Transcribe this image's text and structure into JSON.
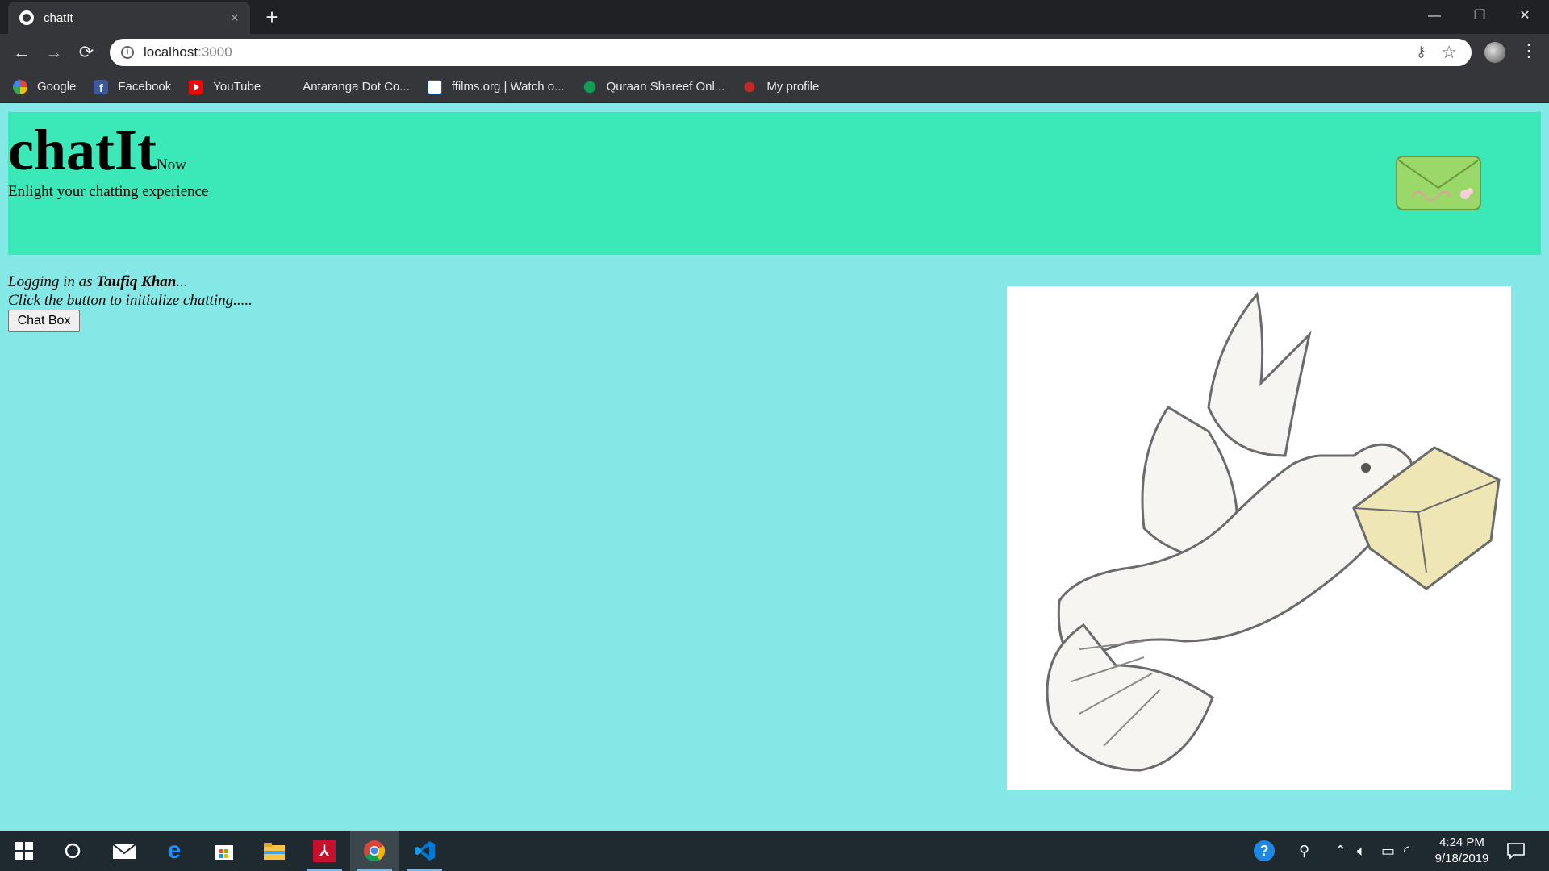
{
  "browser": {
    "tab_title": "chatIt",
    "tab_close": "×",
    "new_tab": "+",
    "window_controls": {
      "minimize": "—",
      "restore": "❐",
      "close": "✕"
    },
    "nav": {
      "back": "←",
      "forward": "→",
      "reload": "⟳"
    },
    "url_host": "localhost",
    "url_port": ":3000",
    "omnibox_icons": {
      "info": "i",
      "key": "⚷",
      "star": "☆"
    },
    "menu": "⋮",
    "bookmarks": [
      {
        "label": "Google",
        "icon": "google-icon"
      },
      {
        "label": "Facebook",
        "icon": "facebook-icon"
      },
      {
        "label": "YouTube",
        "icon": "youtube-icon"
      },
      {
        "label": "Antaranga Dot Co...",
        "icon": "blank-icon"
      },
      {
        "label": "ffilms.org | Watch o...",
        "icon": "ffilms-icon"
      },
      {
        "label": "Quraan Shareef Onl...",
        "icon": "quraan-icon"
      },
      {
        "label": "My profile",
        "icon": "profile-icon"
      }
    ]
  },
  "page": {
    "brand": "chatIt",
    "brand_sub": "Now",
    "tagline": "Enlight your chatting experience",
    "login_prefix": "Logging in as ",
    "user_name": "Taufiq Khan",
    "login_suffix": "...",
    "hint": "Click the button to initialize chatting.....",
    "chat_button": "Chat Box"
  },
  "colors": {
    "header_bg": "#3be8b8",
    "page_bg": "#84e9e6",
    "chrome_bg": "#35363a",
    "titlebar_bg": "#202124"
  },
  "taskbar": {
    "items": [
      "windows-start-icon",
      "cortana-icon",
      "mail-icon",
      "edge-icon",
      "store-icon",
      "file-explorer-icon",
      "acrobat-icon",
      "chrome-icon",
      "vscode-icon"
    ],
    "tray_icons": [
      "help-icon",
      "people-icon",
      "chevron-up-icon",
      "volume-icon",
      "battery-icon",
      "wifi-icon",
      "notification-icon"
    ],
    "time": "4:24 PM",
    "date": "9/18/2019"
  }
}
